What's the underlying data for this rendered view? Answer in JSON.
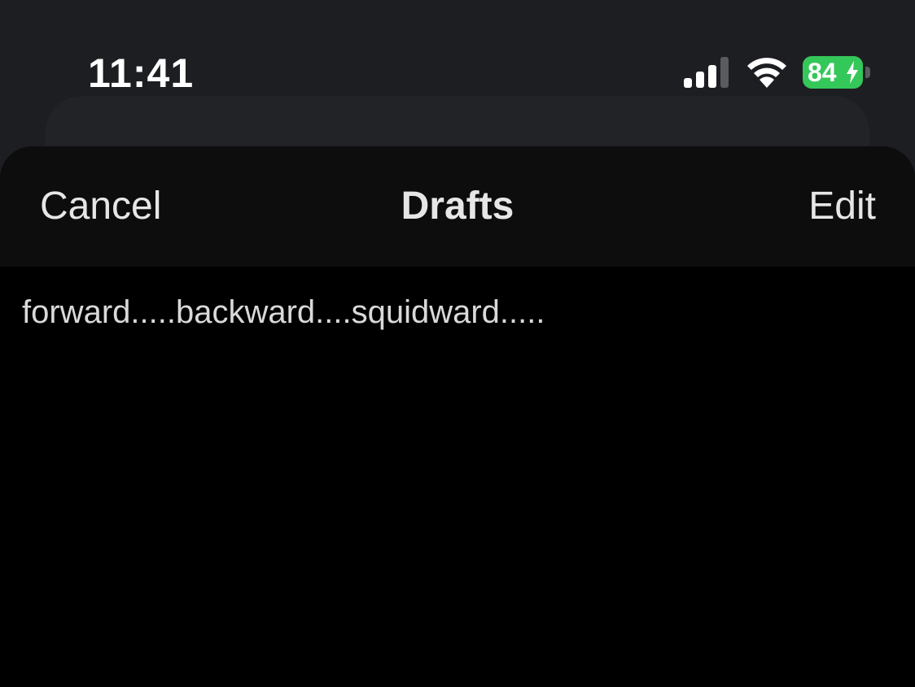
{
  "status_bar": {
    "time": "11:41",
    "battery_level": "84",
    "battery_color": "#34c759",
    "signal_icon": "cellular-signal-icon",
    "wifi_icon": "wifi-icon",
    "battery_icon": "battery-charging-icon"
  },
  "nav": {
    "cancel_label": "Cancel",
    "title": "Drafts",
    "edit_label": "Edit"
  },
  "drafts": [
    {
      "text": "forward.....backward....squidward....."
    }
  ]
}
